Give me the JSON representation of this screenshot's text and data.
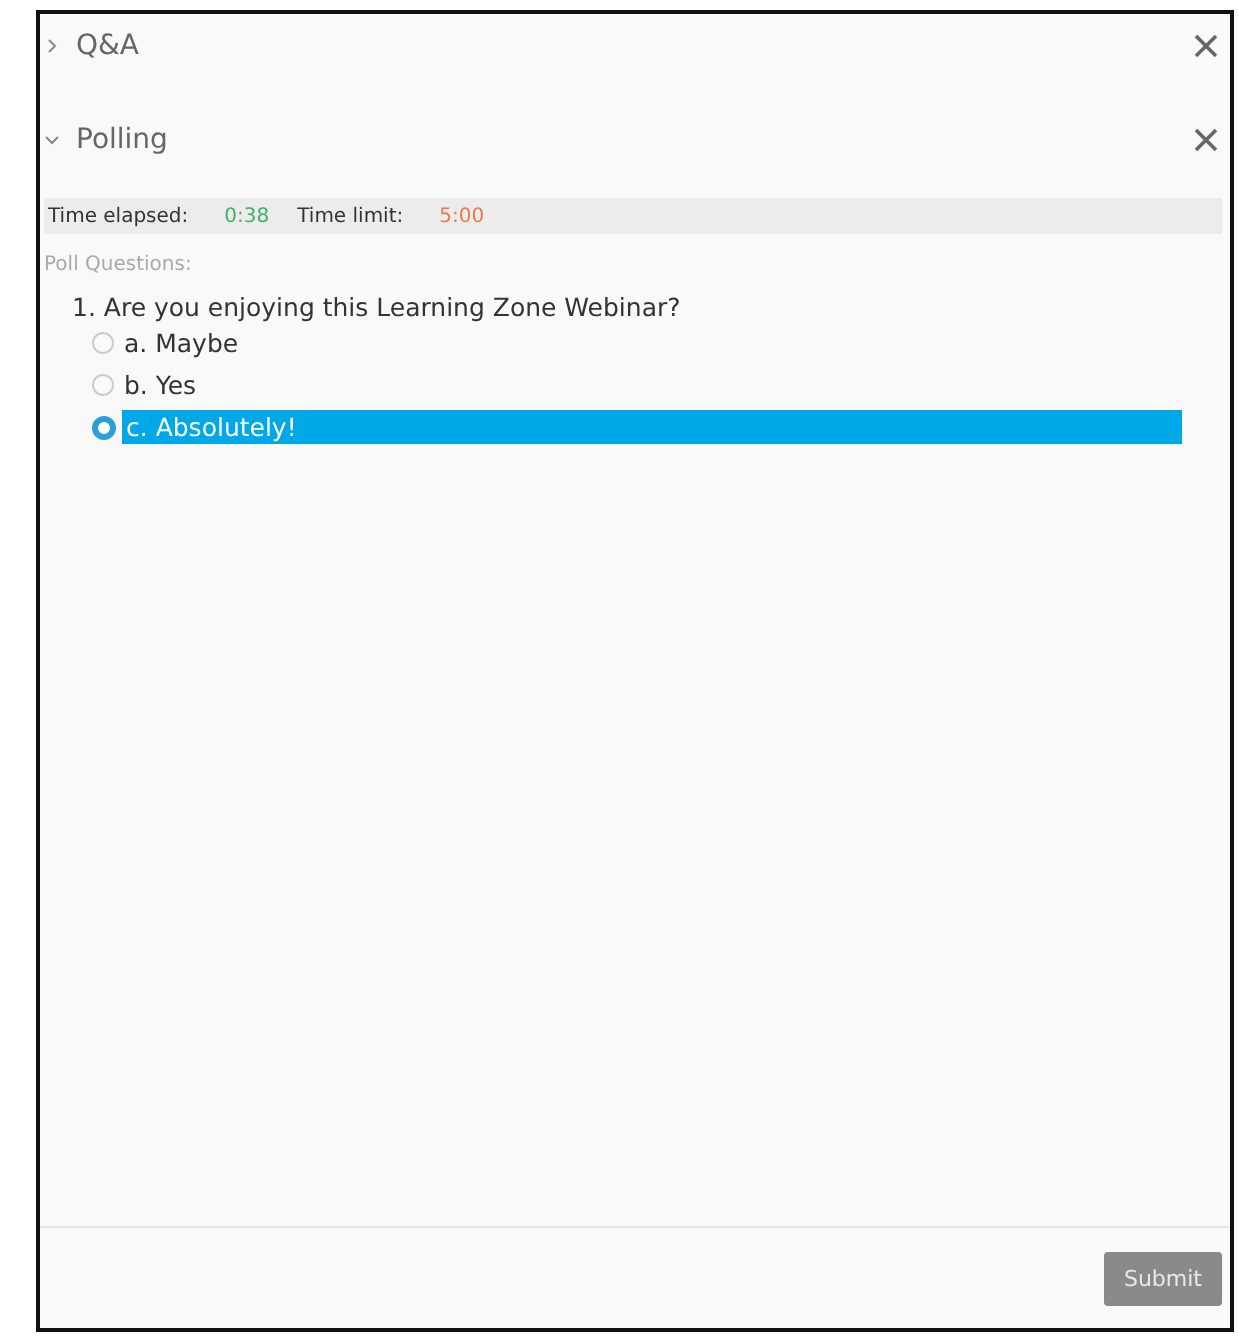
{
  "sections": [
    {
      "title": "Q&A",
      "expanded": false
    },
    {
      "title": "Polling",
      "expanded": true
    }
  ],
  "timer": {
    "elapsed_label": "Time elapsed:",
    "elapsed": "0:38",
    "limit_label": "Time limit:",
    "limit": "5:00"
  },
  "poll_heading": "Poll Questions:",
  "question": "1. Are you enjoying this Learning Zone Webinar?",
  "options": [
    {
      "label": "a. Maybe",
      "selected": false
    },
    {
      "label": "b. Yes",
      "selected": false
    },
    {
      "label": "c. Absolutely!",
      "selected": true
    }
  ],
  "submit": {
    "label": "Submit",
    "disabled": true
  }
}
